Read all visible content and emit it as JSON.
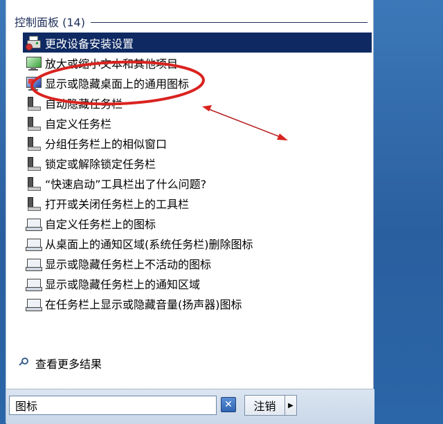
{
  "section": {
    "title": "控制面板 (14)"
  },
  "results": [
    {
      "label": "更改设备安装设置",
      "icon": "device-settings-icon",
      "selected": true
    },
    {
      "label": "放大或缩小文本和其他项目",
      "icon": "display-icon"
    },
    {
      "label": "显示或隐藏桌面上的通用图标",
      "icon": "display-icon"
    },
    {
      "label": "自动隐藏任务栏",
      "icon": "taskbar-icon"
    },
    {
      "label": "自定义任务栏",
      "icon": "taskbar-icon"
    },
    {
      "label": "分组任务栏上的相似窗口",
      "icon": "taskbar-icon"
    },
    {
      "label": "锁定或解除锁定任务栏",
      "icon": "taskbar-icon"
    },
    {
      "label": "“快速启动”工具栏出了什么问题?",
      "icon": "taskbar-icon"
    },
    {
      "label": "打开或关闭任务栏上的工具栏",
      "icon": "taskbar-icon"
    },
    {
      "label": "自定义任务栏上的图标",
      "icon": "notification-area-icon"
    },
    {
      "label": "从桌面上的通知区域(系统任务栏)删除图标",
      "icon": "notification-area-icon"
    },
    {
      "label": "显示或隐藏任务栏上不活动的图标",
      "icon": "notification-area-icon"
    },
    {
      "label": "显示或隐藏任务栏上的通知区域",
      "icon": "notification-area-icon"
    },
    {
      "label": "在任务栏上显示或隐藏音量(扬声器)图标",
      "icon": "notification-area-icon"
    }
  ],
  "more_results": {
    "label": "查看更多结果"
  },
  "search": {
    "value": "图标"
  },
  "buttons": {
    "clear": "✕",
    "logoff": "注销",
    "arrow": "▶"
  },
  "colors": {
    "selected_bg": "#0f2a63",
    "annotation": "#d9231f"
  }
}
